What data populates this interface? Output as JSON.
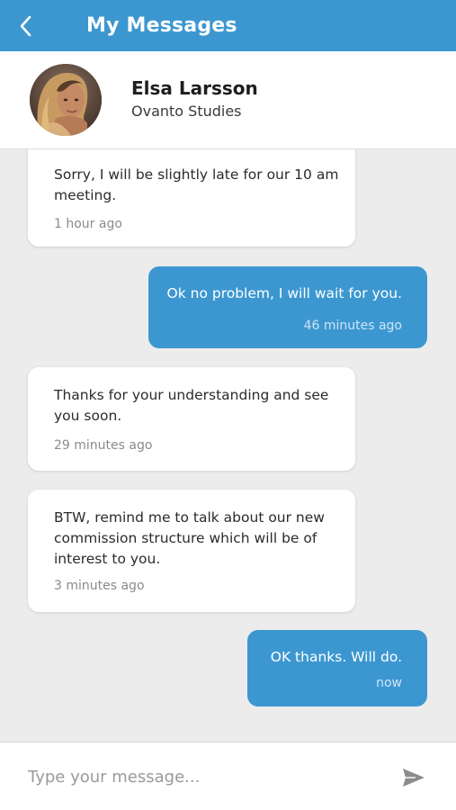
{
  "header": {
    "title": "My Messages",
    "back_icon": "chevron-left-icon"
  },
  "contact": {
    "name": "Elsa Larsson",
    "organization": "Ovanto Studies"
  },
  "messages": [
    {
      "direction": "incoming",
      "text_lines": [
        "Sorry, I will be slightly late for our 10 am",
        "meeting."
      ],
      "time": "1 hour ago"
    },
    {
      "direction": "outgoing",
      "text_lines": [
        "Ok no problem, I will wait for you."
      ],
      "time": "46 minutes ago"
    },
    {
      "direction": "incoming",
      "text_lines": [
        "Thanks for your understanding and see",
        "you soon."
      ],
      "time": "29 minutes ago"
    },
    {
      "direction": "incoming",
      "text_lines": [
        "BTW, remind me to talk about our new",
        "commission structure which will be of",
        "interest to you."
      ],
      "time": "3 minutes ago"
    },
    {
      "direction": "outgoing",
      "text_lines": [
        "OK thanks. Will do."
      ],
      "time": "now"
    }
  ],
  "composer": {
    "placeholder": "Type your message...",
    "value": "",
    "send_icon": "send-icon"
  },
  "colors": {
    "primary": "#3c97d0",
    "background": "#ececec",
    "incoming_bubble": "#ffffff"
  }
}
